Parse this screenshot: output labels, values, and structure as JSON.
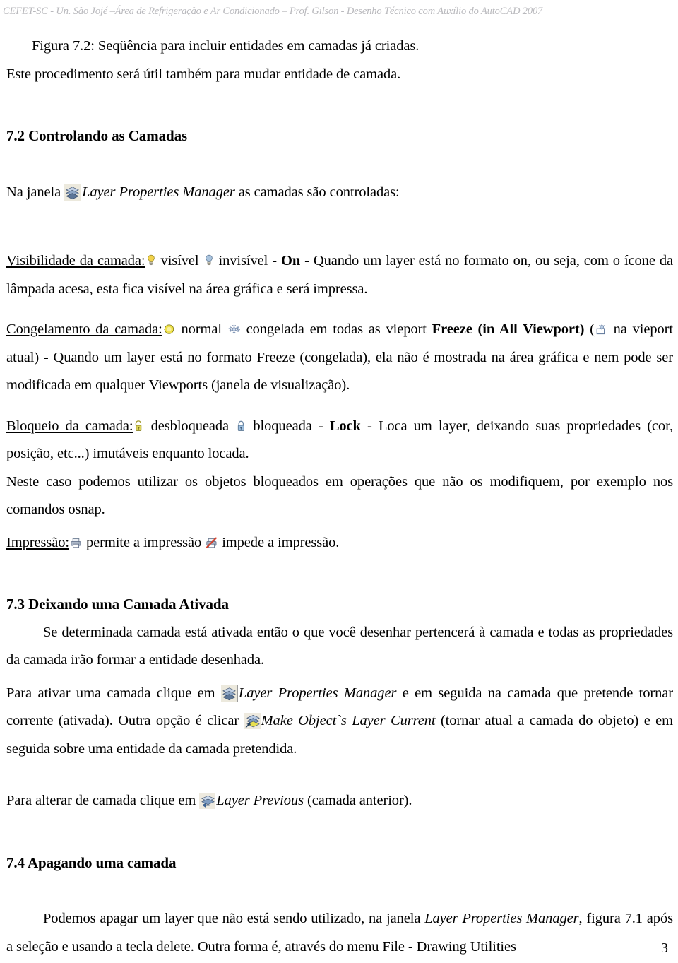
{
  "header": {
    "running_title": "CEFET-SC -  Un. São Jojé –Área de Refrigeração e Ar Condicionado – Prof. Gilson - Desenho Técnico com Auxílio do AutoCAD 2007"
  },
  "figure_caption": {
    "line1": "Figura 7.2: Seqüência para incluir entidades em camadas já criadas.",
    "line2": "Este procedimento será útil também para mudar entidade de camada."
  },
  "sections": {
    "s72": {
      "heading": "7.2 Controlando as Camadas",
      "intro_before_icon": "Na janela ",
      "intro_icon_label": "Layer Properties Manager",
      "intro_after_icon": " as camadas são controladas:",
      "visibility": {
        "label": "Visibilidade da camada:",
        "a": " visível ",
        "b": " invisível - ",
        "bold": "On",
        "c": " - Quando um layer está no formato on, ou seja, com o ícone da lâmpada acesa, esta fica visível na área gráfica e será impressa."
      },
      "freeze": {
        "label": "Congelamento da camada:",
        "a": " normal ",
        "b": " congelada em todas as vieport ",
        "bold": "Freeze (in All Viewport)",
        "c": " (",
        "d": " na vieport atual) - Quando um layer está no formato Freeze (congelada), ela não é mostrada na área gráfica e nem pode ser modificada em qualquer Viewports (janela de visualização)."
      },
      "lock": {
        "label": "Bloqueio da camada:",
        "a": " desbloqueada ",
        "b": " bloqueada - ",
        "bold": "Lock",
        "c": " - Loca um layer, deixando suas propriedades (cor, posição, etc...) imutáveis enquanto locada.",
        "extra": "Neste caso podemos utilizar os objetos bloqueados em operações que não os modifiquem, por exemplo nos comandos osnap."
      },
      "print": {
        "label": "Impressão:",
        "a": " permite a impressão ",
        "b": " impede a impressão."
      }
    },
    "s73": {
      "heading": "7.3 Deixando uma Camada Ativada",
      "p1": "Se determinada camada está ativada então o que você desenhar pertencerá à camada e todas as propriedades da camada irão formar a entidade desenhada.",
      "p2_a": "Para ativar uma camada clique em ",
      "p2_icon_label": "Layer Properties Manager",
      "p2_b": " e em seguida na camada que pretende tornar corrente (ativada). Outra opção é clicar ",
      "p2_icon2_label": "Make Object`s Layer Current",
      "p2_c": " (tornar atual a camada do objeto) e em seguida sobre uma entidade da camada pretendida.",
      "p3_a": "Para alterar de camada clique em ",
      "p3_icon_label": "Layer Previous",
      "p3_b": " (camada anterior)."
    },
    "s74": {
      "heading": "7.4 Apagando uma camada",
      "p1_a": "Podemos apagar um layer que não está sendo utilizado, na janela ",
      "p1_italic": "Layer Properties Manager",
      "p1_b": ", figura 7.1 após a seleção e usando a tecla delete. Outra forma é, através do menu File - Drawing Utilities"
    }
  },
  "footer": {
    "page_number": "3"
  },
  "icons": {
    "layer_properties_manager": "layers-stack-icon",
    "make_objects_layer_current": "layers-stack-arrow-icon",
    "layer_previous": "layers-previous-icon",
    "bulb_on": "lightbulb-on-icon",
    "bulb_off": "lightbulb-off-icon",
    "thaw": "sun-icon",
    "freeze": "snowflake-icon",
    "freeze_viewport": "snowflake-viewport-icon",
    "unlocked": "padlock-open-icon",
    "locked": "padlock-closed-icon",
    "plot": "printer-icon",
    "no_plot": "printer-disabled-icon"
  },
  "colors": {
    "header_text": "#b9b9bd",
    "body_text": "#000000",
    "bulb_on": "#f2d24a",
    "bulb_off": "#a9c3dd",
    "sun": "#f0e24a",
    "snowflake": "#b6c4da",
    "lock_open": "#ddd45a",
    "lock_closed": "#9fc0e0",
    "printer": "#8f9bb0",
    "no_plot_slash": "#d8402a",
    "toolbar_face": "#ece9dd"
  }
}
